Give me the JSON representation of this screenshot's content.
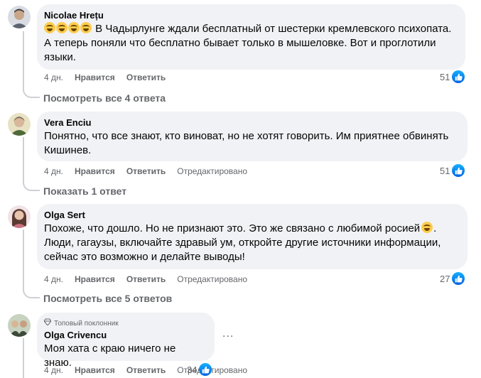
{
  "comments": [
    {
      "author": "Nicolae Hrețu",
      "lines": [
        "В Чадырлунге ждали бесплатный от шестерки кремлевского психопата.",
        "А теперь поняли что бесплатно бывает только в мышеловке. Вот и проглотили",
        "языки."
      ],
      "time": "4 дн.",
      "like_label": "Нравится",
      "reply_label": "Ответить",
      "edited_label": "",
      "reactions": "51",
      "replies_link": "Посмотреть все 4 ответа"
    },
    {
      "author": "Vera Enciu",
      "lines": [
        "Понятно, что все знают, кто виноват, но не хотят говорить. Им приятнее обвинять",
        "Кишинев."
      ],
      "time": "4 дн.",
      "like_label": "Нравится",
      "reply_label": "Ответить",
      "edited_label": "Отредактировано",
      "reactions": "51",
      "replies_link": "Показать 1 ответ"
    },
    {
      "author": "Olga Sert",
      "lines": [
        "Похоже, что дошло. Но не признают это. Это же связано с любимой росией",
        "Люди, гагаузы, включайте здравый ум, откройте другие источники информации,",
        "сейчас это возможно и делайте выводы!"
      ],
      "time": "4 дн.",
      "like_label": "Нравится",
      "reply_label": "Ответить",
      "edited_label": "Отредактировано",
      "reactions": "27",
      "replies_link": "Посмотреть все 5 ответов"
    },
    {
      "badge": "Топовый поклонник",
      "author": "Olga Crivencu",
      "lines": [
        "Моя хата с краю ничего не знаю."
      ],
      "time": "4 дн.",
      "like_label": "Нравится",
      "reply_label": "Ответить",
      "edited_label": "Отредактировано",
      "reactions": "34"
    }
  ],
  "more_options_label": "...",
  "colors": {
    "bubble": "#f0f2f5",
    "secondary_text": "#65676b",
    "like_blue": "#0866ff",
    "thread_line": "#ced0d4"
  },
  "icons": [
    "avatar",
    "like-icon",
    "laughing-emoji",
    "smiling-emoji",
    "diamond-badge-icon",
    "more-options-icon"
  ]
}
